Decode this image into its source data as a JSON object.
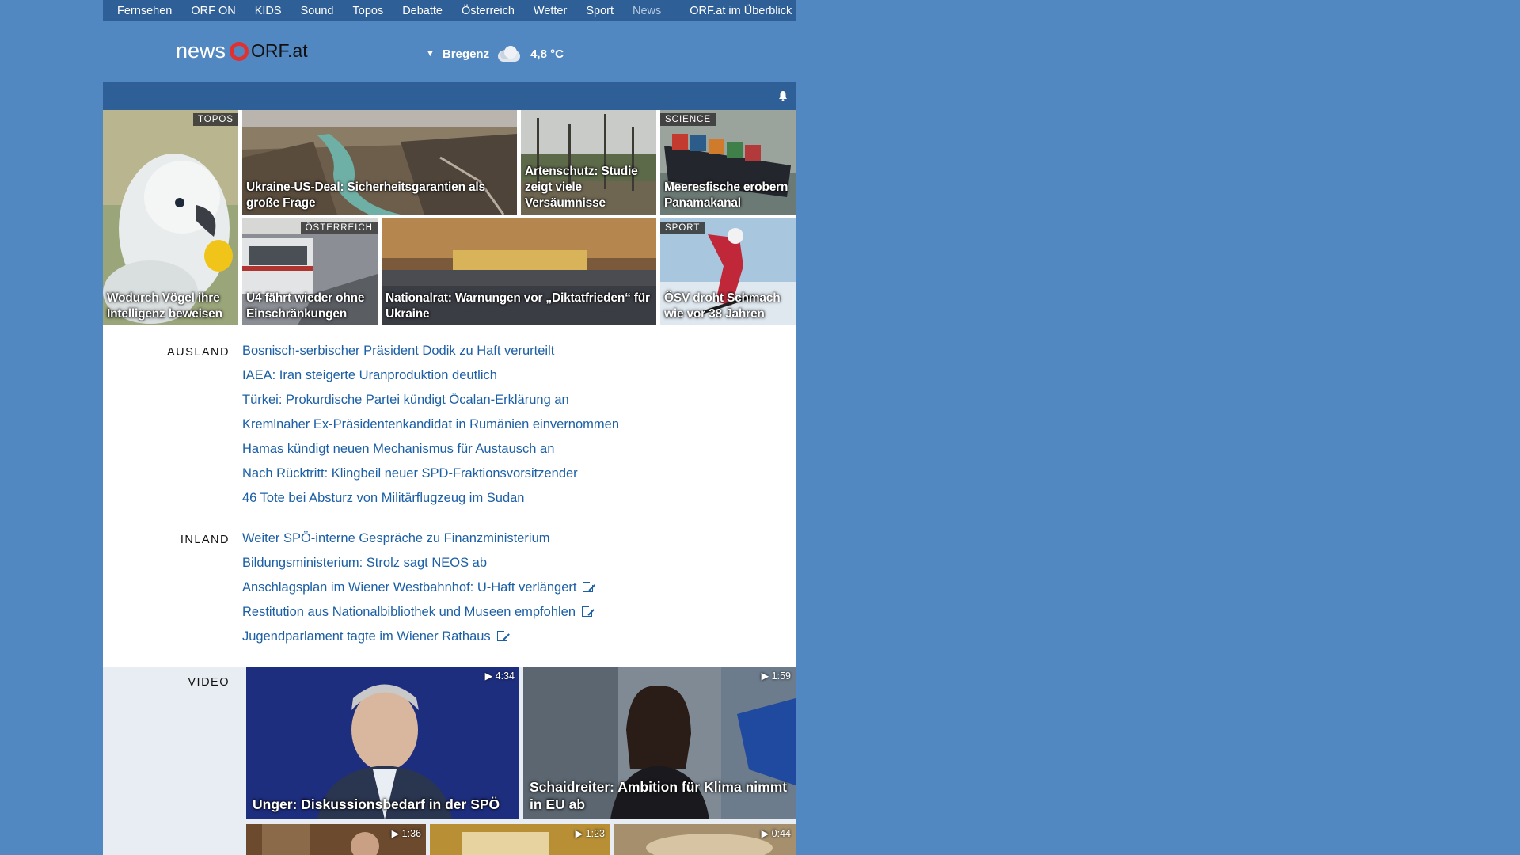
{
  "topnav": {
    "items": [
      "Fernsehen",
      "ORF ON",
      "KIDS",
      "Sound",
      "Topos",
      "Debatte",
      "Österreich",
      "Wetter",
      "Sport",
      "News"
    ],
    "overview": "ORF.at im Überblick"
  },
  "header": {
    "logo_news": "news",
    "logo_orf": "ORF.at",
    "weather": {
      "location": "Bregenz",
      "temperature": "4,8 °C",
      "icon": "cloudy-icon"
    }
  },
  "teasers": [
    {
      "caption": "Wodurch Vögel ihre Intelligenz beweisen",
      "tag": "TOPOS"
    },
    {
      "caption": "Ukraine-US-Deal: Sicherheitsgarantien als große Frage",
      "tag": ""
    },
    {
      "caption": "Artenschutz: Studie zeigt viele Versäumnisse",
      "tag": ""
    },
    {
      "caption": "Meeresfische erobern Panamakanal",
      "tag": "SCIENCE"
    },
    {
      "caption": "U4 fährt wieder ohne Einschränkungen",
      "tag": "ÖSTERREICH"
    },
    {
      "caption": "Nationalrat: Warnungen vor „Diktatfrieden“ für Ukraine",
      "tag": ""
    },
    {
      "caption": "ÖSV droht Schmach wie vor 38 Jahren",
      "tag": "SPORT"
    }
  ],
  "ausland": {
    "label": "AUSLAND",
    "links": [
      "Bosnisch-serbischer Präsident Dodik zu Haft verurteilt",
      "IAEA: Iran steigerte Uranproduktion deutlich",
      "Türkei: Prokurdische Partei kündigt Öcalan-Erklärung an",
      "Kremlnaher Ex-Präsidentenkandidat in Rumänien einvernommen",
      "Hamas kündigt neuen Mechanismus für Austausch an",
      "Nach Rücktritt: Klingbeil neuer SPD-Fraktionsvorsitzender",
      "46 Tote bei Absturz von Militärflugzeug im Sudan"
    ]
  },
  "inland": {
    "label": "INLAND",
    "links": [
      "Weiter SPÖ-interne Gespräche zu Finanzministerium",
      "Bildungsministerium: Strolz sagt NEOS ab",
      "Anschlagsplan im Wiener Westbahnhof: U-Haft verlängert",
      "Restitution aus Nationalbibliothek und Museen empfohlen",
      "Jugendparlament tagte im Wiener Rathaus"
    ]
  },
  "video": {
    "label": "VIDEO",
    "items": [
      {
        "caption": "Unger: Diskussionsbedarf in der SPÖ",
        "duration": "4:34"
      },
      {
        "caption": "Schaidreiter: Ambition für Klima nimmt in EU ab",
        "duration": "1:59"
      },
      {
        "caption": "",
        "duration": "1:36"
      },
      {
        "caption": "",
        "duration": "1:23"
      },
      {
        "caption": "",
        "duration": "0:44"
      }
    ]
  },
  "colors": {
    "background": "#5288c1",
    "nav": "#2f5f97",
    "link": "#1b5fa6",
    "logo_ring": "#e03030"
  }
}
